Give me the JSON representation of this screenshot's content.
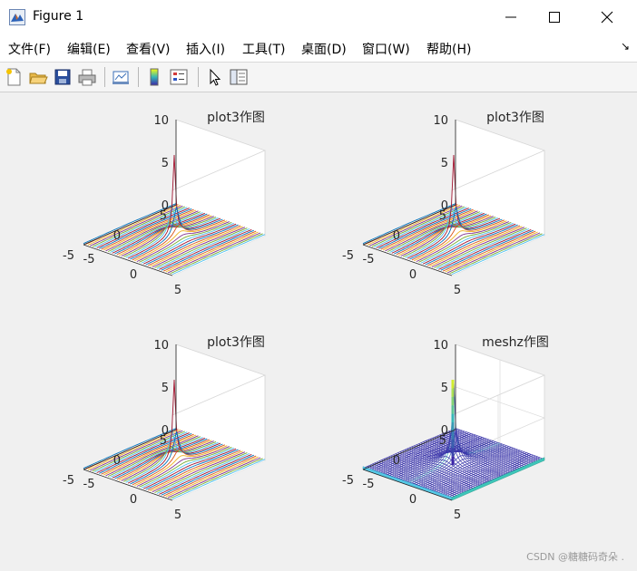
{
  "window": {
    "title": "Figure 1",
    "controls": [
      "minimize",
      "maximize",
      "close"
    ]
  },
  "menu": {
    "items": [
      "文件(F)",
      "编辑(E)",
      "查看(V)",
      "插入(I)",
      "工具(T)",
      "桌面(D)",
      "窗口(W)",
      "帮助(H)"
    ],
    "overflow_glyph": "↘"
  },
  "toolbar": {
    "icons": [
      "new-figure-icon",
      "open-file-icon",
      "save-icon",
      "print-icon",
      "link-plot-icon",
      "colorbar-icon",
      "legend-icon",
      "pointer-icon",
      "property-editor-icon"
    ]
  },
  "colors": {
    "figure_bg": "#f0f0f0",
    "axes_bg": "#ffffff",
    "line_palette": [
      "#0072BD",
      "#D95319",
      "#EDB120",
      "#7E2F8E",
      "#77AC30",
      "#4DBEEE",
      "#A2142F"
    ],
    "mesh_low": "#3d26a8",
    "mesh_high": "#f9fb0e"
  },
  "chart_data": [
    {
      "type": "line",
      "render": "plot3 (3-D line)",
      "title": "plot3作图",
      "surface": "z = 1/sqrt(x^2 + y^2)",
      "x_ticks": [
        "-5",
        "0",
        "5"
      ],
      "y_ticks": [
        "-5",
        "0",
        "5"
      ],
      "z_ticks": [
        "0",
        "5",
        "10"
      ],
      "xlim": [
        -5,
        5
      ],
      "ylim": [
        -5,
        5
      ],
      "zlim": [
        0,
        10
      ],
      "grid": false
    },
    {
      "type": "line",
      "render": "plot3 (3-D line)",
      "title": "plot3作图",
      "surface": "z = 1/sqrt(x^2 + y^2)",
      "x_ticks": [
        "-5",
        "0",
        "5"
      ],
      "y_ticks": [
        "-5",
        "0",
        "5"
      ],
      "z_ticks": [
        "0",
        "5",
        "10"
      ],
      "xlim": [
        -5,
        5
      ],
      "ylim": [
        -5,
        5
      ],
      "zlim": [
        0,
        10
      ],
      "grid": false
    },
    {
      "type": "line",
      "render": "plot3 (3-D line)",
      "title": "plot3作图",
      "surface": "z = 1/sqrt(x^2 + y^2)",
      "x_ticks": [
        "-5",
        "0",
        "5"
      ],
      "y_ticks": [
        "-5",
        "0",
        "5"
      ],
      "z_ticks": [
        "0",
        "5",
        "10"
      ],
      "xlim": [
        -5,
        5
      ],
      "ylim": [
        -5,
        5
      ],
      "zlim": [
        0,
        10
      ],
      "grid": false
    },
    {
      "type": "heatmap",
      "render": "meshz (3-D mesh with curtain)",
      "title": "meshz作图",
      "surface": "z = 1/sqrt(x^2 + y^2)",
      "x_ticks": [
        "-5",
        "0",
        "5"
      ],
      "y_ticks": [
        "-5",
        "0",
        "5"
      ],
      "z_ticks": [
        "0",
        "5",
        "10"
      ],
      "xlim": [
        -5,
        5
      ],
      "ylim": [
        -5,
        5
      ],
      "zlim": [
        0,
        10
      ],
      "grid": true
    }
  ],
  "watermark": "CSDN @糖糖码奇朵 ."
}
